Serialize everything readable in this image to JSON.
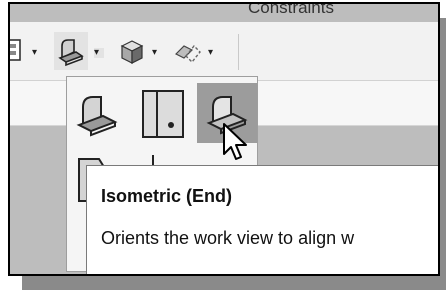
{
  "ribbon": {
    "tab_label": "Constraints"
  },
  "toolbar": {
    "items": [
      {
        "icon": "frame-icon",
        "caret": "▾"
      },
      {
        "icon": "view-orientation-icon",
        "caret": "▾"
      },
      {
        "icon": "shaded-cube-icon",
        "caret": "▾"
      },
      {
        "icon": "hidden-lines-icon",
        "caret": "▾"
      }
    ]
  },
  "view_panel": {
    "buttons": [
      {
        "icon": "isometric-start-icon"
      },
      {
        "icon": "front-view-icon"
      },
      {
        "icon": "isometric-end-icon",
        "active": true
      },
      {
        "icon": "side-view-icon"
      },
      {
        "icon": "top-view-icon"
      },
      {
        "icon": "bottom-view-icon"
      }
    ]
  },
  "tooltip": {
    "title": "Isometric (End)",
    "description": "Orients the work view to align w"
  },
  "colors": {
    "panel_bg": "#f5f5f5",
    "active_button": "#9c9c9c",
    "background": "#bdbdbd",
    "toolbar_bg": "#f2f2f2"
  }
}
